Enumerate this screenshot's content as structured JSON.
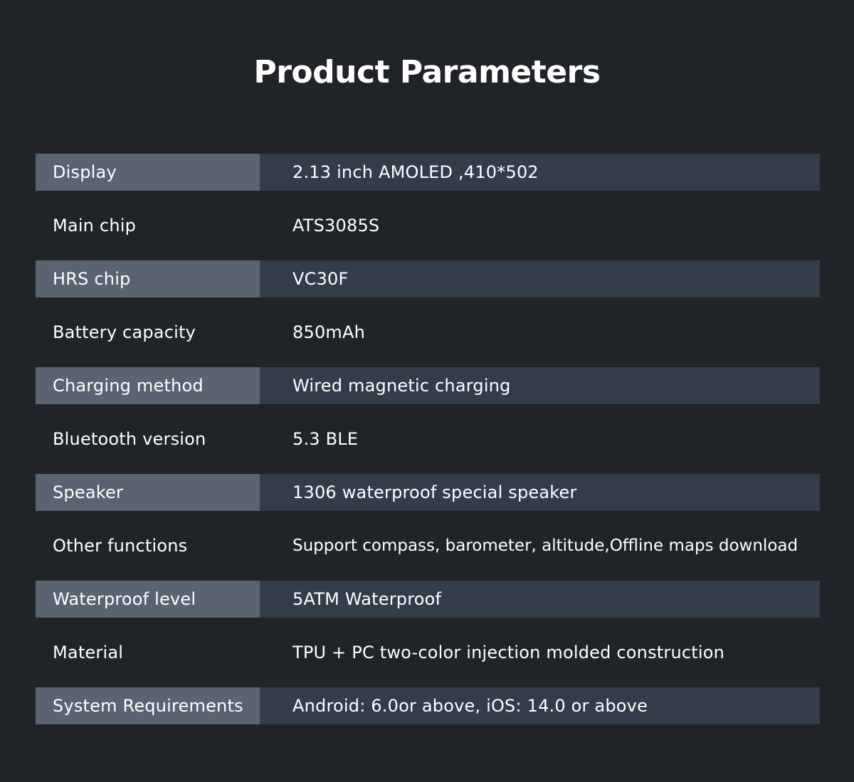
{
  "title": "Product Parameters",
  "rows": [
    {
      "label": "Display",
      "value": "2.13 inch AMOLED ,410*502"
    },
    {
      "label": "Main chip",
      "value": "ATS3085S"
    },
    {
      "label": "HRS chip",
      "value": "VC30F"
    },
    {
      "label": "Battery capacity",
      "value": "850mAh"
    },
    {
      "label": "Charging method",
      "value": "Wired magnetic charging"
    },
    {
      "label": "Bluetooth version",
      "value": "5.3 BLE"
    },
    {
      "label": "Speaker",
      "value": "1306 waterproof special speaker"
    },
    {
      "label": "Other functions",
      "value": "Support compass, barometer, altitude,Offline maps download"
    },
    {
      "label": "Waterproof level",
      "value": "5ATM Waterproof"
    },
    {
      "label": "Material",
      "value": "TPU + PC two-color injection molded construction"
    },
    {
      "label": "System Requirements",
      "value": "Android: 6.0or above, iOS: 14.0 or above"
    }
  ],
  "colors": {
    "background": "#202428",
    "label_shade": "#5a6470",
    "value_shade": "#323d49",
    "text": "#ffffff"
  }
}
